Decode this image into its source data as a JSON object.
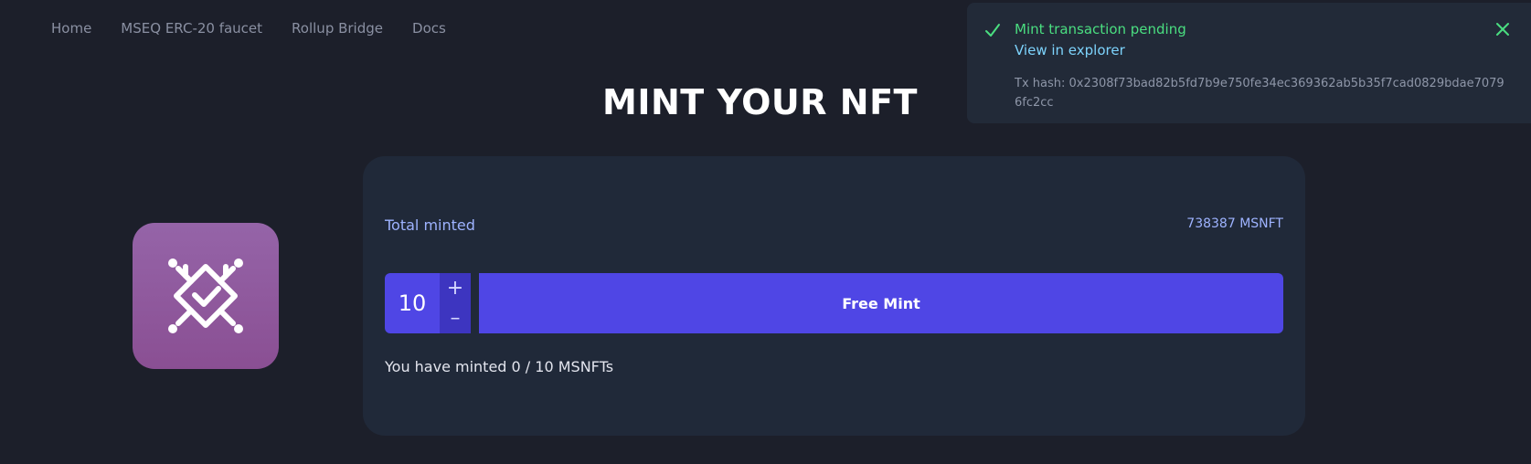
{
  "nav": {
    "items": [
      "Home",
      "MSEQ ERC-20 faucet",
      "Rollup Bridge",
      "Docs"
    ]
  },
  "page_title": "MINT YOUR NFT",
  "card": {
    "total_label": "Total minted",
    "total_value": "738387 MSNFT",
    "quantity": "10",
    "plus_symbol": "+",
    "minus_symbol": "–",
    "mint_button_label": "Free Mint",
    "minted_status": "You have minted 0 / 10 MSNFTs"
  },
  "toast": {
    "title": "Mint transaction pending",
    "link_label": "View in explorer",
    "tx_hash": "Tx hash: 0x2308f73bad82b5fd7b9e750fe34ec369362ab5b35f7cad0829bdae70796fc2cc"
  },
  "colors": {
    "background": "#1c1f2a",
    "card": "#202939",
    "accent": "#4f46e5",
    "success": "#4ade80",
    "link": "#7dd3fc"
  },
  "icons": {
    "logo": "nft-chip-check-icon",
    "toast_status": "check-icon",
    "toast_close": "close-icon"
  }
}
